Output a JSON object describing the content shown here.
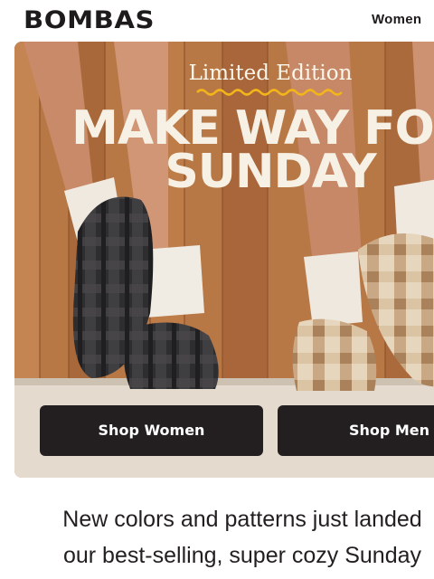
{
  "brand": {
    "logo_text": "BOMBAS"
  },
  "nav": {
    "women_label": "Women"
  },
  "hero": {
    "eyebrow": "Limited Edition",
    "headline_line1": "MAKE WAY FOR",
    "headline_line2": "SUNDAY",
    "buttons": {
      "shop_women": "Shop Women",
      "shop_men": "Shop Men"
    },
    "colors": {
      "headline": "#f6f1e4",
      "squiggle": "#f2b51a",
      "button_bg": "#231f20"
    }
  },
  "body": {
    "line1": "New colors and patterns just landed",
    "line2": "our best-selling, super cozy Sunday"
  }
}
